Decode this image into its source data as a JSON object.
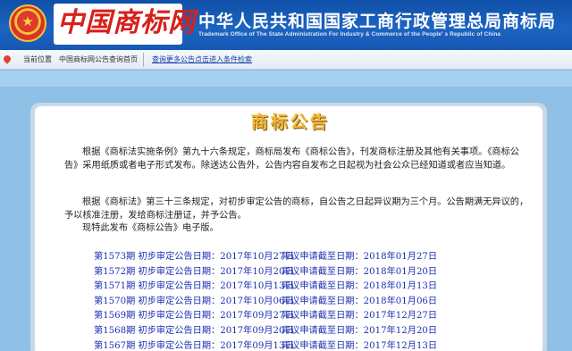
{
  "header": {
    "logo_text": "中国商标网",
    "office_title": "中华人民共和国国家工商行政管理总局商标局",
    "office_subtitle": "Trademark Office of The State Administration For Industry & Commerce of the People' s Republic of China"
  },
  "nav": {
    "location_label": "当前位置",
    "breadcrumb": "中国商标网公告查询首页",
    "search_link": "查询更多公告点击进入条件检索"
  },
  "notice": {
    "title": "商标公告",
    "paragraphs": [
      "根据《商标法实施条例》第九十六条规定，商标局发布《商标公告》，刊发商标注册及其他有关事项。《商标公告》采用纸质或者电子形式发布。除送达公告外，公告内容自发布之日起视为社会公众已经知道或者应当知道。",
      "根据《商标法》第三十三条规定，对初步审定公告的商标，自公告之日起异议期为三个月。公告期满无异议的，予以核准注册，发给商标注册证，并予公告。",
      "现特此发布《商标公告》电子版。"
    ],
    "list": [
      {
        "issue": "第1573期 初步审定公告日期：2017年10月27日",
        "deadline": "异议申请截至日期：2018年01月27日"
      },
      {
        "issue": "第1572期 初步审定公告日期：2017年10月20日",
        "deadline": "异议申请截至日期：2018年01月20日"
      },
      {
        "issue": "第1571期 初步审定公告日期：2017年10月13日",
        "deadline": "异议申请截至日期：2018年01月13日"
      },
      {
        "issue": "第1570期 初步审定公告日期：2017年10月06日",
        "deadline": "异议申请截至日期：2018年01月06日"
      },
      {
        "issue": "第1569期 初步审定公告日期：2017年09月27日",
        "deadline": "异议申请截至日期：2017年12月27日"
      },
      {
        "issue": "第1568期 初步审定公告日期：2017年09月20日",
        "deadline": "异议申请截至日期：2017年12月20日"
      },
      {
        "issue": "第1567期 初步审定公告日期：2017年09月13日",
        "deadline": "异议申请截至日期：2017年12月13日"
      }
    ]
  },
  "colors": {
    "header_blue": "#1558b4",
    "logo_red": "#d7201c",
    "title_gold": "#f2b33a",
    "link_blue": "#1f30b0",
    "page_bg": "#8fc0e6"
  },
  "icons": [
    "national-emblem-icon",
    "location-pin-icon"
  ]
}
